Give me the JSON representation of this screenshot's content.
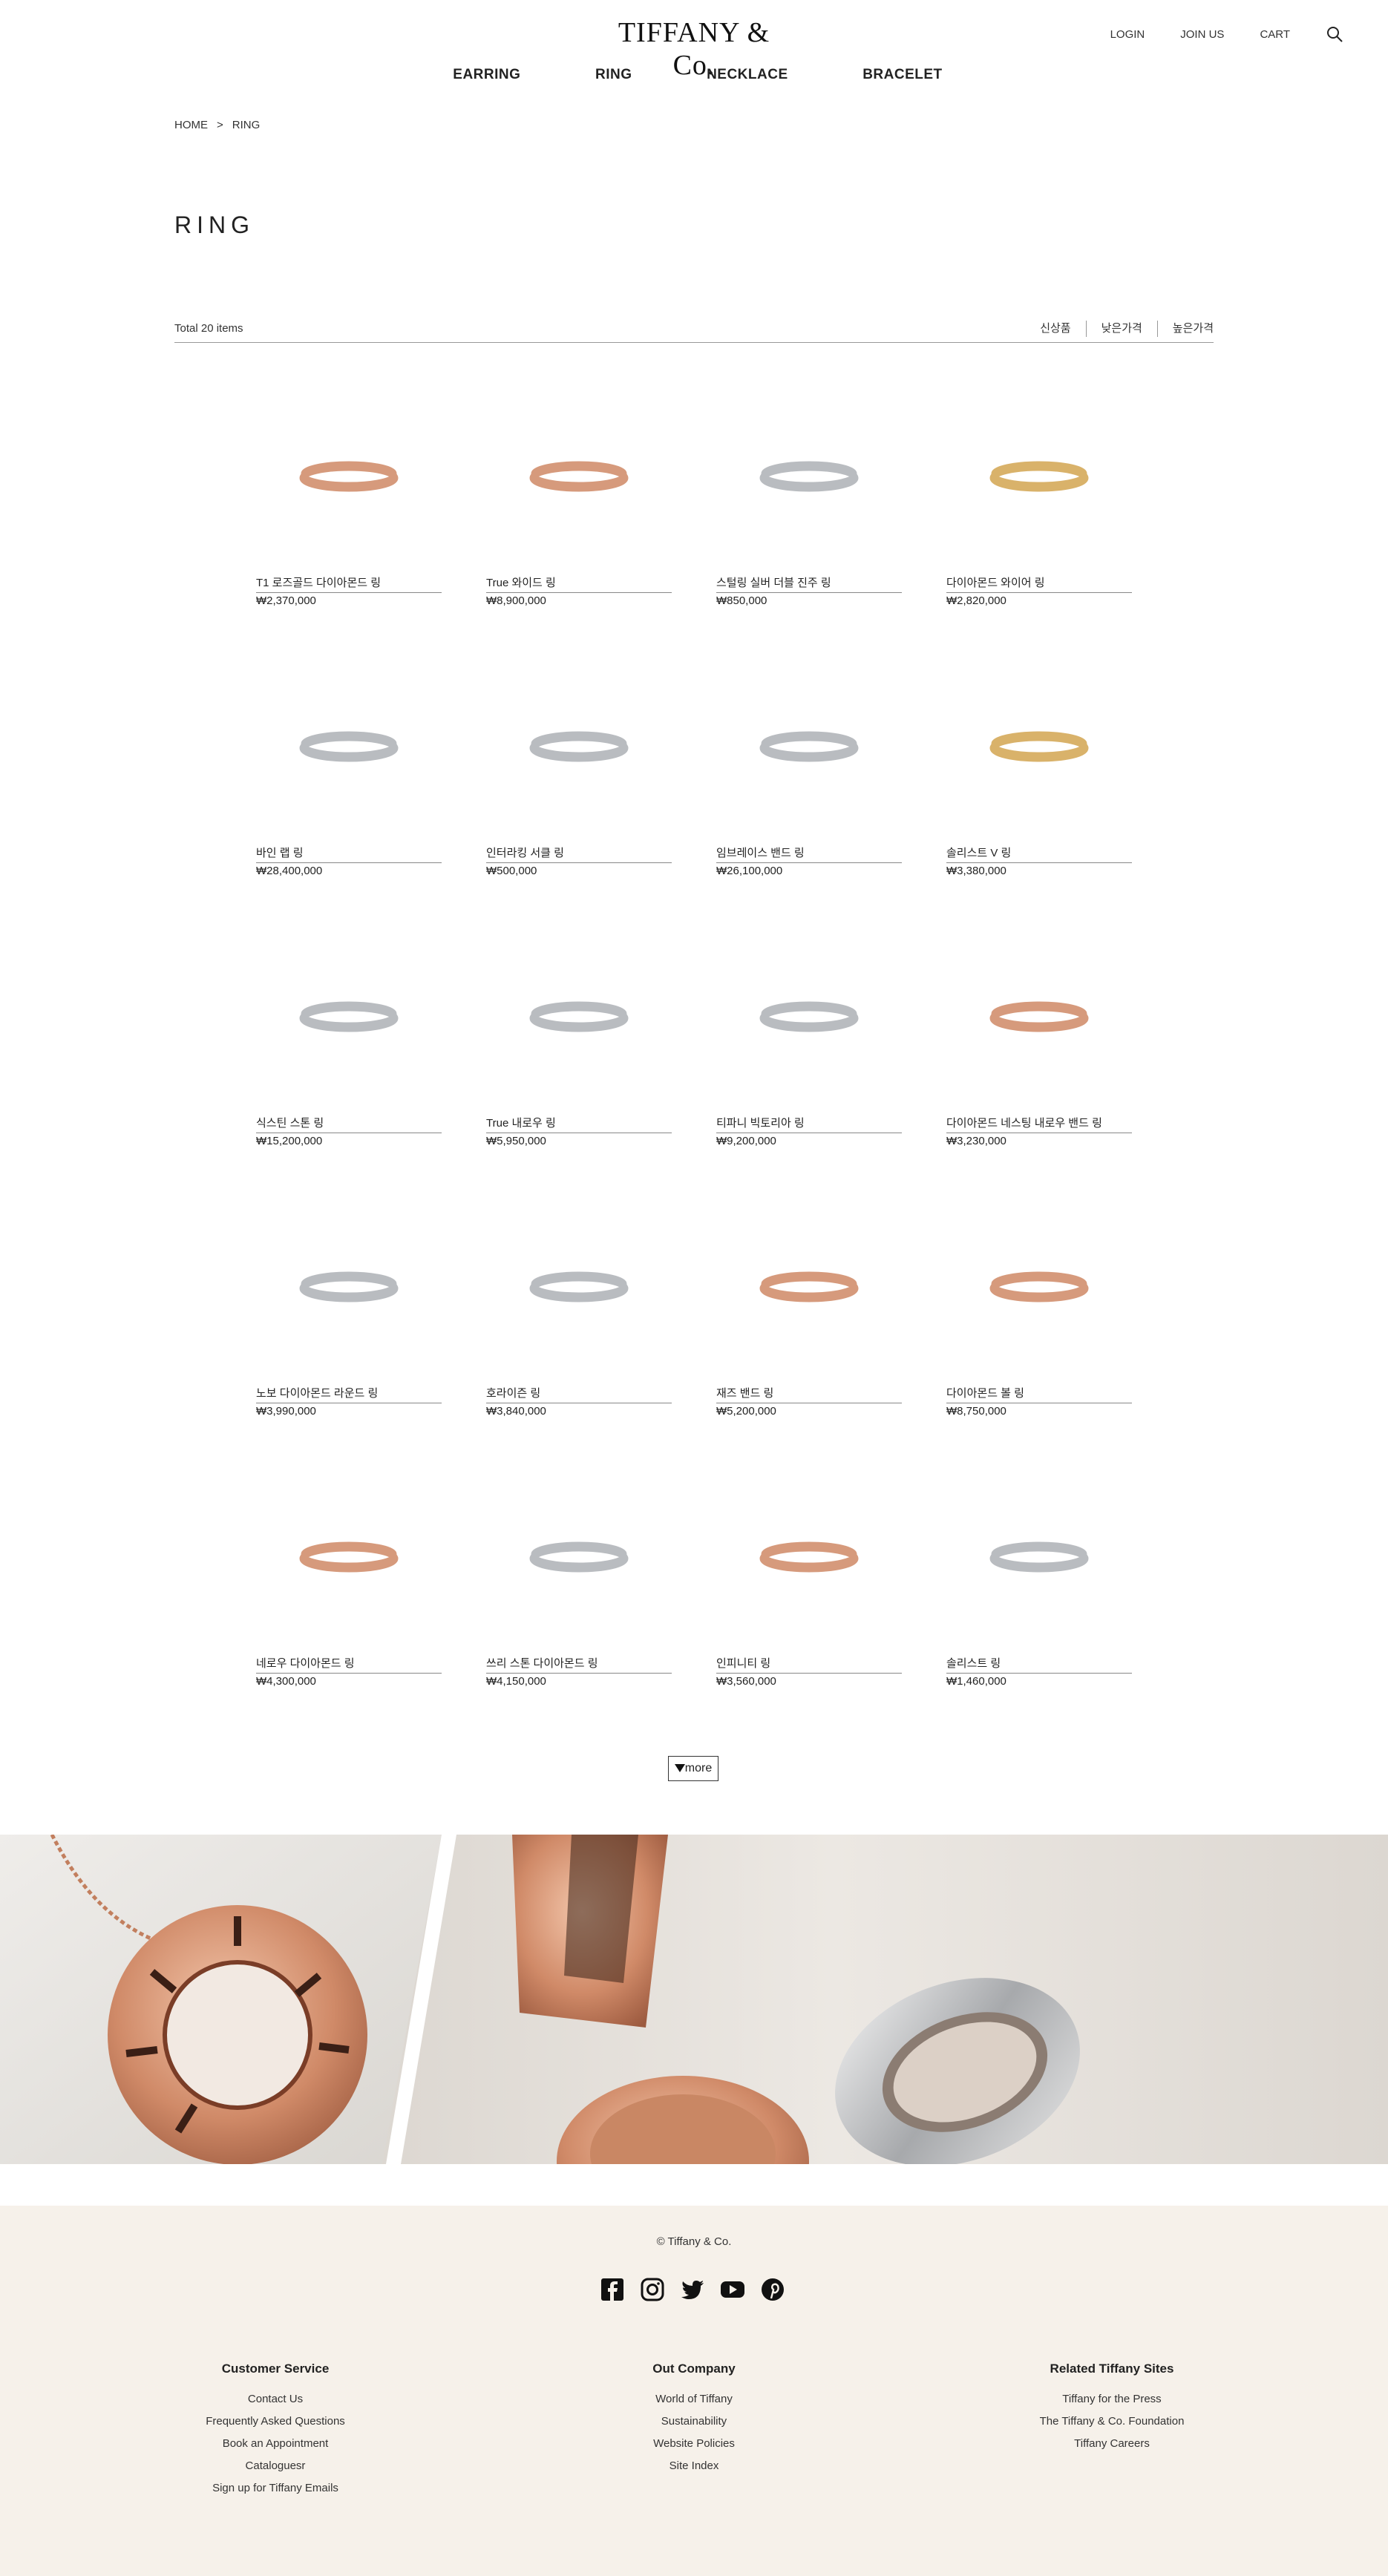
{
  "header": {
    "logo": "TIFFANY & Co.",
    "login": "LOGIN",
    "join": "JOIN US",
    "cart": "CART",
    "search_icon": "search-icon",
    "nav": [
      "EARRING",
      "RING",
      "NECKLACE",
      "BRACELET"
    ]
  },
  "breadcrumb": {
    "home": "HOME",
    "sep": ">",
    "current": "RING"
  },
  "page_title": "RING",
  "toolbar": {
    "total": "Total 20 items",
    "sort": [
      "신상품",
      "낮은가격",
      "높은가격"
    ]
  },
  "products": [
    {
      "name": "T1 로즈골드 다이아몬드 링",
      "price": "₩2,370,000",
      "metal": "rose"
    },
    {
      "name": "True 와이드 링",
      "price": "₩8,900,000",
      "metal": "rose"
    },
    {
      "name": "스털링 실버 더블 진주 링",
      "price": "₩850,000",
      "metal": "silver"
    },
    {
      "name": "다이아몬드 와이어 링",
      "price": "₩2,820,000",
      "metal": "gold"
    },
    {
      "name": "바인 랩 링",
      "price": "₩28,400,000",
      "metal": "silver"
    },
    {
      "name": "인터라킹 서클 링",
      "price": "₩500,000",
      "metal": "silver"
    },
    {
      "name": "임브레이스 밴드 링",
      "price": "₩26,100,000",
      "metal": "silver"
    },
    {
      "name": "솔리스트 V 링",
      "price": "₩3,380,000",
      "metal": "gold"
    },
    {
      "name": "식스틴 스톤 링",
      "price": "₩15,200,000",
      "metal": "silver"
    },
    {
      "name": "True 내로우 링",
      "price": "₩5,950,000",
      "metal": "silver"
    },
    {
      "name": "티파니 빅토리아 링",
      "price": "₩9,200,000",
      "metal": "silver"
    },
    {
      "name": "다이아몬드 네스팅 내로우 밴드 링",
      "price": "₩3,230,000",
      "metal": "rose"
    },
    {
      "name": "노보 다이아몬드 라운드 링",
      "price": "₩3,990,000",
      "metal": "silver"
    },
    {
      "name": "호라이즌 링",
      "price": "₩3,840,000",
      "metal": "silver"
    },
    {
      "name": "재즈 밴드 링",
      "price": "₩5,200,000",
      "metal": "rose"
    },
    {
      "name": "다이아몬드 볼 링",
      "price": "₩8,750,000",
      "metal": "rose"
    },
    {
      "name": "네로우 다이아몬드 링",
      "price": "₩4,300,000",
      "metal": "rose"
    },
    {
      "name": "쓰리 스톤 다이아몬드 링",
      "price": "₩4,150,000",
      "metal": "silver"
    },
    {
      "name": "인피니티 링",
      "price": "₩3,560,000",
      "metal": "rose"
    },
    {
      "name": "솔리스트 링",
      "price": "₩1,460,000",
      "metal": "silver"
    }
  ],
  "more_button": "more",
  "colors": {
    "rose": "#d69a7c",
    "gold": "#d9b26a",
    "silver": "#b9bcc0",
    "footer_bg": "#f6f1ea"
  },
  "footer": {
    "copyright": "© Tiffany & Co.",
    "social_icons": [
      "facebook-icon",
      "instagram-icon",
      "twitter-icon",
      "youtube-icon",
      "pinterest-icon"
    ],
    "columns": [
      {
        "title": "Customer Service",
        "links": [
          "Contact Us",
          "Frequently Asked Questions",
          "Book an Appointment",
          "Cataloguesr",
          "Sign up for Tiffany Emails"
        ]
      },
      {
        "title": "Out Company",
        "links": [
          "World of Tiffany",
          "Sustainability",
          "Website Policies",
          "Site Index"
        ]
      },
      {
        "title": "Related Tiffany Sites",
        "links": [
          "Tiffany for the Press",
          "The Tiffany & Co. Foundation",
          "Tiffany Careers"
        ]
      }
    ]
  }
}
